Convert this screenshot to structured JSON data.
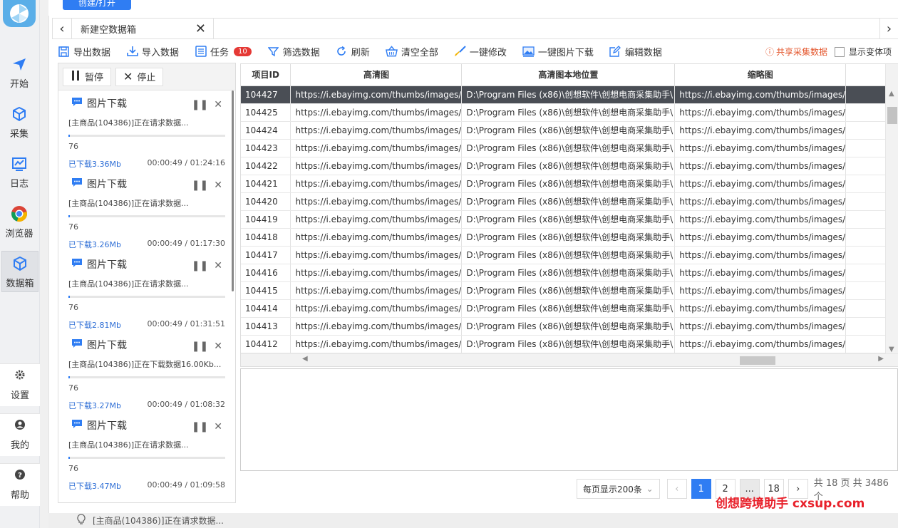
{
  "nav": {
    "items": [
      {
        "label": "开始"
      },
      {
        "label": "采集"
      },
      {
        "label": "日志"
      },
      {
        "label": "浏览器"
      },
      {
        "label": "数据箱"
      }
    ],
    "bottom": [
      {
        "label": "设置"
      },
      {
        "label": "我的"
      },
      {
        "label": "帮助"
      }
    ]
  },
  "top": {
    "create_label": "创建/打开"
  },
  "tab": {
    "label": "新建空数据箱"
  },
  "toolbar": {
    "items": [
      {
        "label": "导出数据"
      },
      {
        "label": "导入数据"
      },
      {
        "label": "任务",
        "badge": "10"
      },
      {
        "label": "筛选数据"
      },
      {
        "label": "刷新"
      },
      {
        "label": "清空全部"
      },
      {
        "label": "一键修改"
      },
      {
        "label": "一键图片下载"
      },
      {
        "label": "编辑数据"
      }
    ],
    "share_label": "共享采集数据",
    "variant_label": "显示变体项"
  },
  "tasks": {
    "pause_label": "暂停",
    "stop_label": "停止",
    "items": [
      {
        "title": "图片下载",
        "msg": "[主商品(104386)]正在请求数据...",
        "progress": 0.01,
        "pct": "76",
        "downloaded": "已下载3.36Mb",
        "time": "00:00:49 / 01:24:16"
      },
      {
        "title": "图片下载",
        "msg": "[主商品(104386)]正在请求数据...",
        "progress": 0.01,
        "pct": "76",
        "downloaded": "已下载3.26Mb",
        "time": "00:00:49 / 01:17:30"
      },
      {
        "title": "图片下载",
        "msg": "[主商品(104386)]正在请求数据...",
        "progress": 0.01,
        "pct": "76",
        "downloaded": "已下载2.81Mb",
        "time": "00:00:49 / 01:31:51"
      },
      {
        "title": "图片下载",
        "msg": "[主商品(104386)]正在下载数据16.00Kb...",
        "progress": 0.01,
        "pct": "76",
        "downloaded": "已下载3.27Mb",
        "time": "00:00:49 / 01:08:32"
      },
      {
        "title": "图片下载",
        "msg": "[主商品(104386)]正在请求数据...",
        "progress": 0.01,
        "pct": "76",
        "downloaded": "已下载3.47Mb",
        "time": "00:00:49 / 01:09:58"
      }
    ]
  },
  "grid": {
    "columns": [
      "项目ID",
      "高清图",
      "高清图本地位置",
      "缩略图"
    ],
    "rows": [
      [
        "104427",
        "https://i.ebayimg.com/thumbs/images/",
        "D:\\Program Files (x86)\\创想软件\\创想电商采集助手\\",
        "https://i.ebayimg.com/thumbs/images/"
      ],
      [
        "104425",
        "https://i.ebayimg.com/thumbs/images/",
        "D:\\Program Files (x86)\\创想软件\\创想电商采集助手\\",
        "https://i.ebayimg.com/thumbs/images/"
      ],
      [
        "104424",
        "https://i.ebayimg.com/thumbs/images/",
        "D:\\Program Files (x86)\\创想软件\\创想电商采集助手\\",
        "https://i.ebayimg.com/thumbs/images/"
      ],
      [
        "104423",
        "https://i.ebayimg.com/thumbs/images/",
        "D:\\Program Files (x86)\\创想软件\\创想电商采集助手\\",
        "https://i.ebayimg.com/thumbs/images/"
      ],
      [
        "104422",
        "https://i.ebayimg.com/thumbs/images/",
        "D:\\Program Files (x86)\\创想软件\\创想电商采集助手\\",
        "https://i.ebayimg.com/thumbs/images/"
      ],
      [
        "104421",
        "https://i.ebayimg.com/thumbs/images/",
        "D:\\Program Files (x86)\\创想软件\\创想电商采集助手\\",
        "https://i.ebayimg.com/thumbs/images/"
      ],
      [
        "104420",
        "https://i.ebayimg.com/thumbs/images/",
        "D:\\Program Files (x86)\\创想软件\\创想电商采集助手\\",
        "https://i.ebayimg.com/thumbs/images/"
      ],
      [
        "104419",
        "https://i.ebayimg.com/thumbs/images/",
        "D:\\Program Files (x86)\\创想软件\\创想电商采集助手\\",
        "https://i.ebayimg.com/thumbs/images/"
      ],
      [
        "104418",
        "https://i.ebayimg.com/thumbs/images/",
        "D:\\Program Files (x86)\\创想软件\\创想电商采集助手\\",
        "https://i.ebayimg.com/thumbs/images/"
      ],
      [
        "104417",
        "https://i.ebayimg.com/thumbs/images/",
        "D:\\Program Files (x86)\\创想软件\\创想电商采集助手\\",
        "https://i.ebayimg.com/thumbs/images/"
      ],
      [
        "104416",
        "https://i.ebayimg.com/thumbs/images/",
        "D:\\Program Files (x86)\\创想软件\\创想电商采集助手\\",
        "https://i.ebayimg.com/thumbs/images/"
      ],
      [
        "104415",
        "https://i.ebayimg.com/thumbs/images/",
        "D:\\Program Files (x86)\\创想软件\\创想电商采集助手\\",
        "https://i.ebayimg.com/thumbs/images/"
      ],
      [
        "104414",
        "https://i.ebayimg.com/thumbs/images/",
        "D:\\Program Files (x86)\\创想软件\\创想电商采集助手\\",
        "https://i.ebayimg.com/thumbs/images/"
      ],
      [
        "104413",
        "https://i.ebayimg.com/thumbs/images/",
        "D:\\Program Files (x86)\\创想软件\\创想电商采集助手\\",
        "https://i.ebayimg.com/thumbs/images/"
      ],
      [
        "104412",
        "https://i.ebayimg.com/thumbs/images/",
        "D:\\Program Files (x86)\\创想软件\\创想电商采集助手\\",
        "https://i.ebayimg.com/thumbs/images/"
      ]
    ]
  },
  "pager": {
    "page_size": "每页显示200条",
    "pages": [
      "1",
      "2",
      "...",
      "18"
    ],
    "active": "1",
    "total": "共 18 页 共 3486 个"
  },
  "watermark": "创想跨境助手  cxsup.com",
  "status": {
    "msg": "[主商品(104386)]正在请求数据..."
  },
  "colors": {
    "accent": "#2f7df3",
    "selected_row": "#4a4e55",
    "badge": "#e53935",
    "share": "#e4572e",
    "watermark": "#e8202a"
  }
}
